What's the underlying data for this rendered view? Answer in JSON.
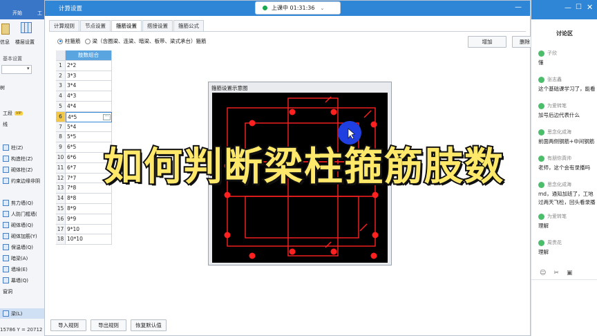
{
  "left_panel": {
    "tab_start": "开始",
    "tab_project": "工",
    "ribbon_info": "信息",
    "ribbon_floor": "楼层设置",
    "group_basic": "基本设置",
    "tree_label": "树",
    "items": [
      {
        "label": "工段",
        "vip": "VIP"
      },
      {
        "label": "线"
      },
      {
        "label": "柱(Z)"
      },
      {
        "label": "构造柱(Z)"
      },
      {
        "label": "砌体柱(Z)"
      },
      {
        "label": "约束边缘非阴"
      },
      {
        "label": "剪力墙(Q)"
      },
      {
        "label": "人防门框墙("
      },
      {
        "label": "砌体墙(Q)"
      },
      {
        "label": "砌体加筋(Y)"
      },
      {
        "label": "保温墙(Q)"
      },
      {
        "label": "暗梁(A)"
      },
      {
        "label": "墙垛(E)"
      },
      {
        "label": "幕墙(Q)"
      },
      {
        "label": "窗洞"
      },
      {
        "label": "梁(L)"
      }
    ],
    "coord_readout": "15786 Y = 20712"
  },
  "dialog": {
    "title": "计算设置",
    "status": "上课中 01:31:36",
    "tabs": [
      "计算规则",
      "节点设置",
      "箍筋设置",
      "搭接设置",
      "箍筋公式"
    ],
    "active_tab": 2,
    "radio_column": "柱箍筋",
    "radio_beam": "梁（含圈梁、连梁、暗梁、板带、梁式承台）箍筋",
    "add_button": "增加",
    "delete_button": "删除",
    "table_header": "肢数组合",
    "rows": [
      {
        "idx": "1",
        "val": "2*2"
      },
      {
        "idx": "2",
        "val": "3*3"
      },
      {
        "idx": "3",
        "val": "3*4"
      },
      {
        "idx": "4",
        "val": "4*3"
      },
      {
        "idx": "5",
        "val": "4*4"
      },
      {
        "idx": "6",
        "val": "4*5"
      },
      {
        "idx": "7",
        "val": "5*4"
      },
      {
        "idx": "8",
        "val": "5*5"
      },
      {
        "idx": "9",
        "val": "6*5"
      },
      {
        "idx": "10",
        "val": "6*6"
      },
      {
        "idx": "11",
        "val": "6*7"
      },
      {
        "idx": "12",
        "val": "7*7"
      },
      {
        "idx": "13",
        "val": "7*8"
      },
      {
        "idx": "14",
        "val": "8*8"
      },
      {
        "idx": "15",
        "val": "8*9"
      },
      {
        "idx": "16",
        "val": "9*9"
      },
      {
        "idx": "17",
        "val": "9*10"
      },
      {
        "idx": "18",
        "val": "10*10"
      }
    ],
    "selected_row": 5,
    "ellipsis": "···",
    "diagram_title": "箍筋设置示意图",
    "import_button": "导入规则",
    "export_button": "导出规则",
    "restore_button": "恢复默认值"
  },
  "overlay_title": "如何判断梁柱箍筋肢数",
  "chat": {
    "title": "讨论区",
    "messages": [
      {
        "user": "子欣",
        "text": "懂"
      },
      {
        "user": "张志鑫",
        "text": "这个基础课学习了，能看"
      },
      {
        "user": "为爱转笔",
        "text": "加号后边代表什么"
      },
      {
        "user": "思念化成海",
        "text": "前面两侧钢筋+中间钢筋"
      },
      {
        "user": "有朋你真帅",
        "text": "老师，这个会有录播吗"
      },
      {
        "user": "思念化成海",
        "text": "md，通知加班了，工地"
      },
      {
        "user": "",
        "text": "过两天飞检，回头看录播"
      },
      {
        "user": "为爱转笔",
        "text": "理解"
      },
      {
        "user": "周贵花",
        "text": "理解"
      }
    ]
  },
  "colors": {
    "accent": "#2f86d6",
    "rebar": "#ff2020",
    "diagram_bg": "#000000",
    "overlay_text": "#ffe86a",
    "cursor_dot": "#1f3fe0"
  }
}
